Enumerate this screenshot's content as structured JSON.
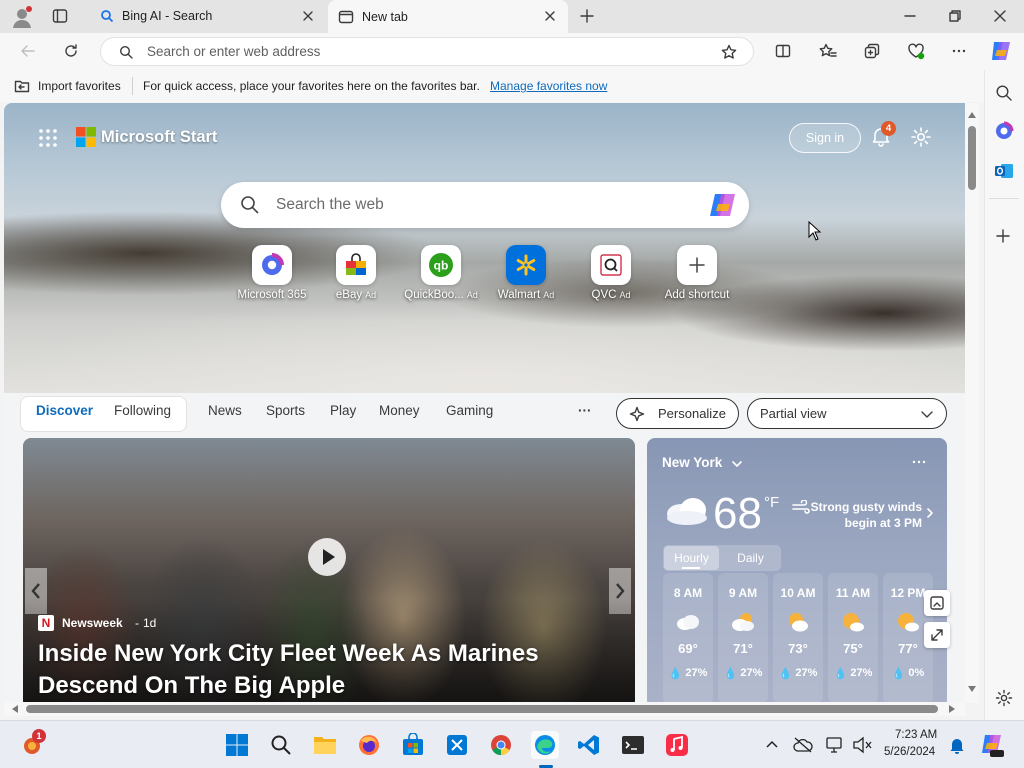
{
  "tabs": [
    {
      "title": "Bing AI - Search"
    },
    {
      "title": "New tab"
    }
  ],
  "toolbar": {
    "address_placeholder": "Search or enter web address"
  },
  "favorites_bar": {
    "import_label": "Import favorites",
    "message": "For quick access, place your favorites here on the favorites bar.",
    "manage_link": "Manage favorites now"
  },
  "page": {
    "brand": "Microsoft Start",
    "sign_in": "Sign in",
    "notification_count": "4",
    "search_placeholder": "Search the web",
    "quick_links": [
      {
        "label": "Microsoft 365",
        "ad": ""
      },
      {
        "label": "eBay",
        "ad": "Ad"
      },
      {
        "label": "QuickBoo...",
        "ad": "Ad"
      },
      {
        "label": "Walmart",
        "ad": "Ad"
      },
      {
        "label": "QVC",
        "ad": "Ad"
      },
      {
        "label": "Add shortcut",
        "ad": ""
      }
    ],
    "feed_tabs": {
      "discover": "Discover",
      "following": "Following",
      "news": "News",
      "sports": "Sports",
      "play": "Play",
      "money": "Money",
      "gaming": "Gaming",
      "more": "···"
    },
    "personalize": "Personalize",
    "view_select": "Partial view",
    "news": {
      "source": "Newsweek",
      "age": "1d",
      "source_badge": "N",
      "headline": "Inside New York City Fleet Week As Marines Descend On The Big Apple"
    },
    "weather": {
      "location": "New York",
      "temp": "68",
      "unit": "°F",
      "alert": "Strong gusty winds begin at 3 PM",
      "tab_hourly": "Hourly",
      "tab_daily": "Daily",
      "hours": [
        {
          "time": "8 AM",
          "temp": "69°",
          "precip": "27%"
        },
        {
          "time": "9 AM",
          "temp": "71°",
          "precip": "27%"
        },
        {
          "time": "10 AM",
          "temp": "73°",
          "precip": "27%"
        },
        {
          "time": "11 AM",
          "temp": "75°",
          "precip": "27%"
        },
        {
          "time": "12 PM",
          "temp": "77°",
          "precip": "0%"
        }
      ]
    }
  },
  "taskbar": {
    "time": "7:23 AM",
    "date": "5/26/2024",
    "weather_badge": "1"
  },
  "colors": {
    "accent": "#0f6cbd",
    "link": "#0f6cbd"
  }
}
